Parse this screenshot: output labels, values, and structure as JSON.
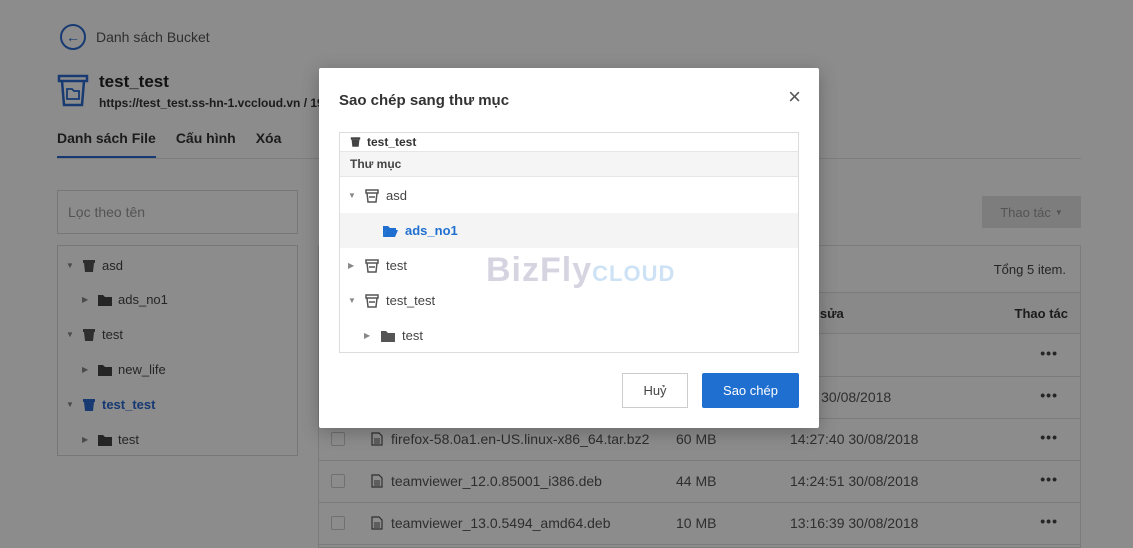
{
  "back": {
    "label": "Danh sách Bucket"
  },
  "bucket": {
    "name": "test_test",
    "url": "https://test_test.ss-hn-1.vccloud.vn  /  19"
  },
  "tabs": [
    {
      "label": "Danh sách File"
    },
    {
      "label": "Cấu hình"
    },
    {
      "label": "Xóa"
    }
  ],
  "filter": {
    "placeholder": "Lọc theo tên"
  },
  "sidebar": {
    "nodes": [
      {
        "label": "asd"
      },
      {
        "label": "ads_no1"
      },
      {
        "label": "test"
      },
      {
        "label": "new_life"
      },
      {
        "label": "test_test"
      },
      {
        "label": "test"
      }
    ]
  },
  "toolbar": {
    "actions_label": "Thao tác"
  },
  "table": {
    "total": "Tổng 5 item.",
    "col_modified": "y sửa",
    "col_actions": "Thao tác",
    "rows": [
      {
        "name": "",
        "size": "",
        "date": ""
      },
      {
        "name": "",
        "size": "",
        "date": "7:15 30/08/2018"
      },
      {
        "name": "firefox-58.0a1.en-US.linux-x86_64.tar.bz2",
        "size": "60 MB",
        "date": "14:27:40 30/08/2018"
      },
      {
        "name": "teamviewer_12.0.85001_i386.deb",
        "size": "44 MB",
        "date": "14:24:51 30/08/2018"
      },
      {
        "name": "teamviewer_13.0.5494_amd64.deb",
        "size": "10 MB",
        "date": "13:16:39 30/08/2018"
      }
    ],
    "row_menu": "•••"
  },
  "modal": {
    "title": "Sao chép sang thư mục",
    "close": "×",
    "tree_root": "test_test",
    "tree_header": "Thư mục",
    "nodes": [
      {
        "label": "asd"
      },
      {
        "label": "ads_no1"
      },
      {
        "label": "test"
      },
      {
        "label": "test_test"
      },
      {
        "label": "test"
      }
    ],
    "watermark": "BizFly",
    "watermark_sub": "CLOUD",
    "cancel_label": "Huỷ",
    "copy_label": "Sao chép"
  }
}
